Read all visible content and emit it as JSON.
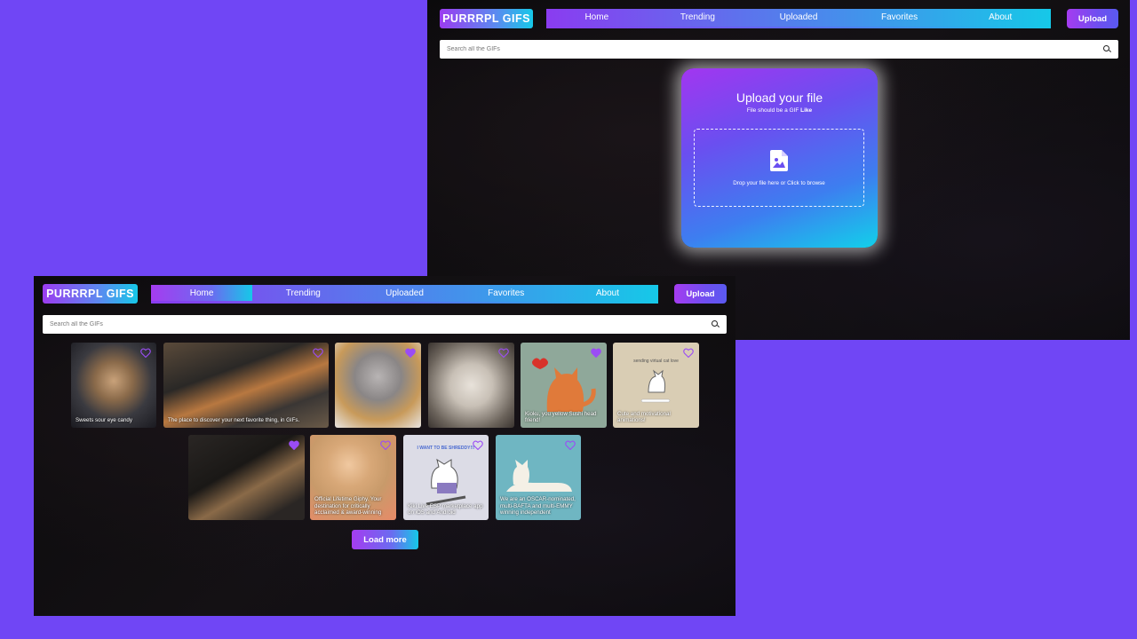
{
  "brand": {
    "logo_text": "PURRRPL GIFS"
  },
  "nav": {
    "items": [
      {
        "label": "Home"
      },
      {
        "label": "Trending"
      },
      {
        "label": "Uploaded"
      },
      {
        "label": "Favorites"
      },
      {
        "label": "About"
      }
    ],
    "upload_label": "Upload"
  },
  "search": {
    "placeholder": "Search all the GIFs"
  },
  "upload_page": {
    "title": "Upload your file",
    "subtitle_prefix": "File should be a GIF",
    "subtitle_emphasis": "Like",
    "drop_text": "Drop your file here or Click to browse"
  },
  "home_page": {
    "gifs": [
      {
        "caption": "Sweets sour eye candy",
        "liked": false
      },
      {
        "caption": "The place to discover your next favorite thing, in GIFs.",
        "liked": false
      },
      {
        "caption": "",
        "liked": true
      },
      {
        "caption": "",
        "liked": false
      },
      {
        "caption": "Kioku, you yellow Sushi head friend!",
        "liked": true
      },
      {
        "caption": "Cute and motivational animations!",
        "liked": false,
        "inner_text": "sending virtual cat love"
      },
      {
        "caption": "",
        "liked": true
      },
      {
        "caption": "Official Lifetime Giphy. Your destination for critically acclaimed & award-winning",
        "liked": false
      },
      {
        "caption": "Kiki Live ESP marketplace app on iOS and Android",
        "liked": false,
        "inner_text": "I WANT TO BE SHREDDY!!!"
      },
      {
        "caption": "We are an OSCAR-nominated, multi-BAFTA and multi-EMMY winning independent",
        "liked": false
      }
    ],
    "load_more_label": "Load more"
  },
  "colors": {
    "page_bg": "#7046f5",
    "accent_purple": "#a53cf0",
    "accent_cyan": "#16c8e8",
    "heart_color": "#9b4cf5"
  }
}
